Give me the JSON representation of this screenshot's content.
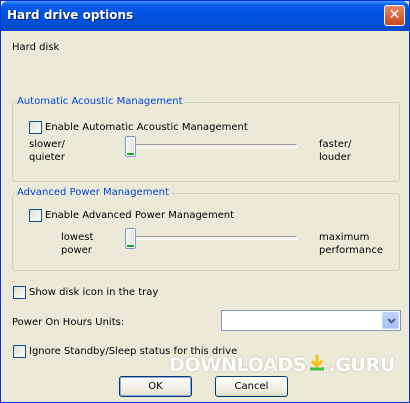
{
  "window": {
    "title": "Hard drive options"
  },
  "icons": {
    "close": "close-icon",
    "dropdown": "chevron-down-icon",
    "download": "download-arrow-icon"
  },
  "colors": {
    "titlebar": "#0054e3",
    "group_title": "#0046d5",
    "slider_green": "#21a121"
  },
  "hard_disk_label": "Hard disk",
  "acoustic": {
    "group_title": "Automatic Acoustic Management",
    "checkbox_label": "Enable Automatic Acoustic Management",
    "checked": false,
    "left_label": "slower/\nquieter",
    "right_label": "faster/\nlouder",
    "slider_value": 0
  },
  "power": {
    "group_title": "Advanced Power Management",
    "checkbox_label": "Enable Advanced Power Management",
    "checked": false,
    "left_label": "lowest\npower",
    "right_label": "maximum\nperformance",
    "slider_value": 0
  },
  "tray_checkbox": {
    "label": "Show disk icon in the tray",
    "checked": false
  },
  "power_on_hours": {
    "label": "Power On Hours Units:",
    "value": ""
  },
  "standby_checkbox": {
    "label": "Ignore Standby/Sleep status for this drive",
    "checked": false
  },
  "buttons": {
    "ok": "OK",
    "cancel": "Cancel"
  },
  "watermark": {
    "part1": "DOWNLOADS",
    "part2": ".GURU"
  }
}
